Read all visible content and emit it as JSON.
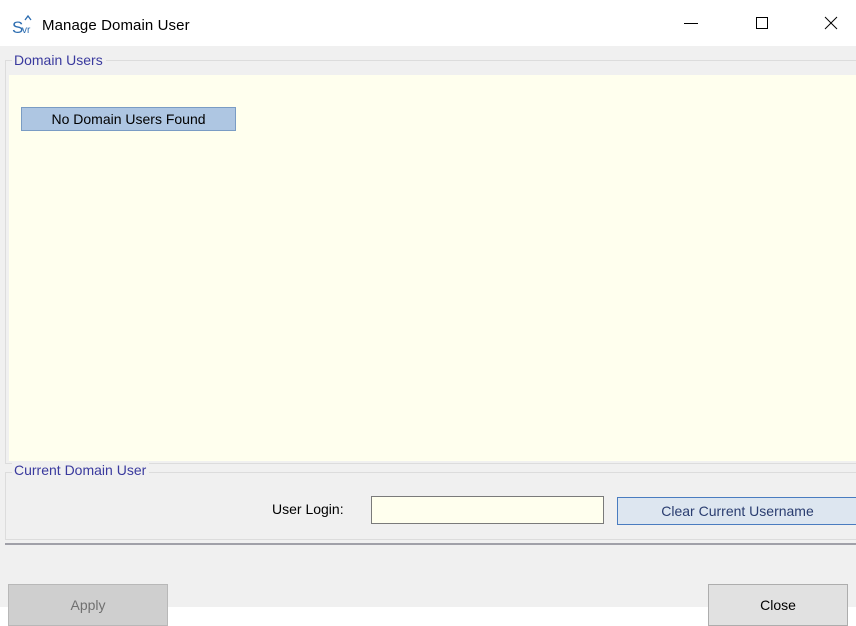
{
  "window": {
    "title": "Manage Domain User",
    "icon": "svr-app-icon",
    "icon_letter": "S",
    "icon_sub": "vr"
  },
  "domain_users": {
    "legend": "Domain Users",
    "empty_message": "No Domain Users Found"
  },
  "current_user": {
    "legend": "Current Domain User",
    "login_label": "User Login:",
    "login_value": "",
    "clear_button": "Clear Current Username"
  },
  "footer": {
    "apply_label": "Apply",
    "close_label": "Close"
  },
  "colors": {
    "list_background": "#ffffee",
    "legend_text": "#3a3a9e",
    "selected_item": "#aec6e2",
    "focus_border": "#4a7cc0"
  }
}
